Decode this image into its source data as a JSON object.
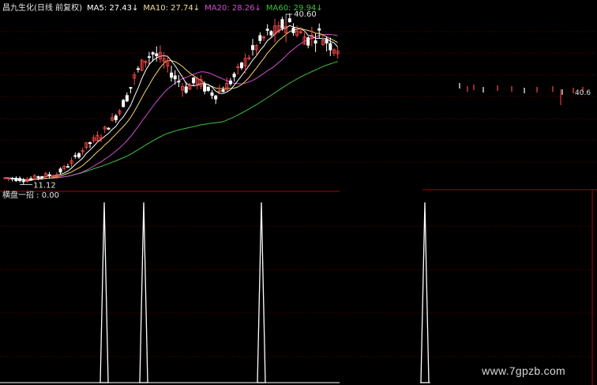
{
  "header": {
    "stock": "昌九生化(日线 前复权)",
    "ma5": "MA5: 27.43",
    "ma10": "MA10: 27.74",
    "ma20": "MA20: 28.26",
    "ma60": "MA60: 29.94",
    "arrow": "↓"
  },
  "indicator": {
    "label": "横盘一招 : 0.00"
  },
  "watermark": "www.7gpzb.com",
  "colors": {
    "background": "#000000",
    "up": "#ff4a4a",
    "down": "#ffffff",
    "ma5": "#ffffff",
    "ma10": "#f2d36b",
    "ma20": "#d050d0",
    "ma60": "#40c040",
    "grid": "#7a0000",
    "separator": "#b00000",
    "signal": "#ffffff"
  },
  "chart_data": [
    {
      "type": "candlestick",
      "annotations": [
        {
          "text": "40.60",
          "kind": "high"
        },
        {
          "text": "11.12",
          "kind": "low"
        },
        {
          "text": "40.6",
          "kind": "high-partial"
        }
      ],
      "price_range": [
        11.12,
        40.6
      ],
      "series": [
        {
          "name": "MA5",
          "value": 27.43
        },
        {
          "name": "MA10",
          "value": 27.74
        },
        {
          "name": "MA20",
          "value": 28.26
        },
        {
          "name": "MA60",
          "value": 29.94
        }
      ]
    },
    {
      "type": "line",
      "series": [
        {
          "name": "横盘一招",
          "last_value": 0.0
        }
      ],
      "signal_bars": [
        13,
        18,
        33,
        54
      ]
    }
  ]
}
